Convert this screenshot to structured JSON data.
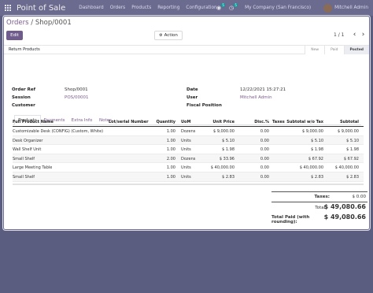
{
  "navbar": {
    "app_name": "Point of Sale",
    "menu": [
      "Dashboard",
      "Orders",
      "Products",
      "Reporting",
      "Configuration"
    ],
    "chat_count": "5",
    "activity_count": "5",
    "company": "My Company (San Francisco)",
    "user": "Mitchell Admin"
  },
  "breadcrumb": {
    "parent": "Orders",
    "separator": " / ",
    "current": "Shop/0001"
  },
  "buttons": {
    "edit": "Edit",
    "action": "Action",
    "return_products": "Return Products"
  },
  "pager": {
    "value": "1 / 1"
  },
  "status": {
    "stages": [
      "New",
      "Paid",
      "Posted"
    ],
    "active": "Posted"
  },
  "form": {
    "order_ref_label": "Order Ref",
    "order_ref": "Shop/0001",
    "session_label": "Session",
    "session": "POS/00001",
    "customer_label": "Customer",
    "customer": "",
    "date_label": "Date",
    "date": "12/22/2021 15:27:21",
    "user_label": "User",
    "user": "Mitchell Admin",
    "fiscal_label": "Fiscal Position",
    "fiscal": ""
  },
  "tabs": [
    "Products",
    "Payments",
    "Extra Info",
    "Notes"
  ],
  "table": {
    "headers": [
      "Full Product Name",
      "Lot/serial Number",
      "Quantity",
      "UoM",
      "Unit Price",
      "Disc.%",
      "Taxes",
      "Subtotal w/o Tax",
      "Subtotal"
    ],
    "rows": [
      [
        "Customizable Desk (CONFIG) (Custom, White)",
        "",
        "1.00",
        "Dozens",
        "$ 9,000.00",
        "0.00",
        "",
        "$ 9,000.00",
        "$ 9,000.00"
      ],
      [
        "Desk Organizer",
        "",
        "1.00",
        "Units",
        "$ 5.10",
        "0.00",
        "",
        "$ 5.10",
        "$ 5.10"
      ],
      [
        "Wall Shelf Unit",
        "",
        "1.00",
        "Units",
        "$ 1.98",
        "0.00",
        "",
        "$ 1.98",
        "$ 1.98"
      ],
      [
        "Small Shelf",
        "",
        "2.00",
        "Dozens",
        "$ 33.96",
        "0.00",
        "",
        "$ 67.92",
        "$ 67.92"
      ],
      [
        "Large Meeting Table",
        "",
        "1.00",
        "Units",
        "$ 40,000.00",
        "0.00",
        "",
        "$ 40,000.00",
        "$ 40,000.00"
      ],
      [
        "Small Shelf",
        "",
        "1.00",
        "Units",
        "$ 2.83",
        "0.00",
        "",
        "$ 2.83",
        "$ 2.83"
      ]
    ]
  },
  "totals": {
    "taxes_label": "Taxes:",
    "taxes": "$ 0.00",
    "total_label": "Total:",
    "total": "$ 49,080.66",
    "paid_label": "Total Paid (with rounding):",
    "paid": "$ 49,080.66"
  }
}
